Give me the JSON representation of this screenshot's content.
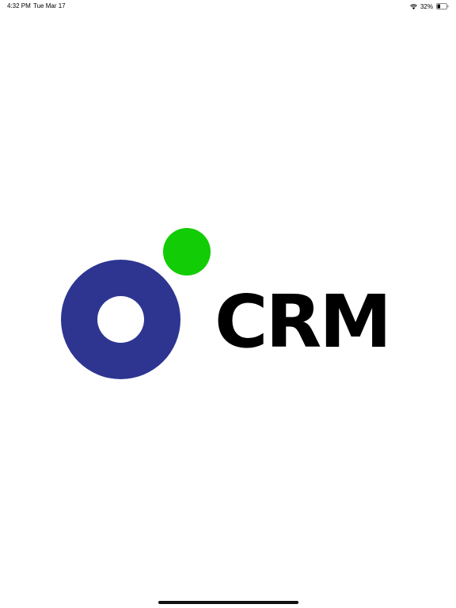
{
  "status_bar": {
    "time": "4:32 PM",
    "date": "Tue Mar 17",
    "battery_percent": "32%",
    "battery_level": 0.32,
    "wifi_icon": "wifi-icon",
    "battery_icon": "battery-icon"
  },
  "logo": {
    "text": "CRM",
    "ring_color": "#2d3591",
    "dot_color": "#12cc05"
  }
}
